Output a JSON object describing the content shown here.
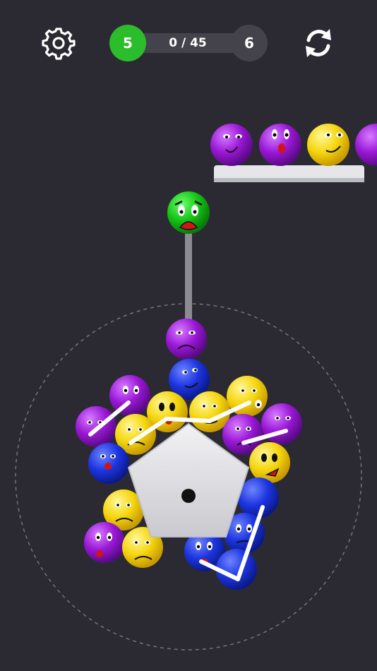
{
  "header": {
    "level_current": "5",
    "level_next": "6",
    "progress_text": "0 / 45",
    "progress_value": 0,
    "progress_max": 45
  },
  "icons": {
    "settings": "gear-icon",
    "restart": "restart-icon"
  },
  "colors": {
    "background": "#2b2a33",
    "green": "#2bbd2b",
    "purple": "#9a18d6",
    "blue": "#1d35e0",
    "yellow": "#f5d60e",
    "shelf": "#e6e6ea"
  },
  "queue_balls": [
    "purple",
    "purple",
    "yellow",
    "purple"
  ],
  "active_ball": "green"
}
